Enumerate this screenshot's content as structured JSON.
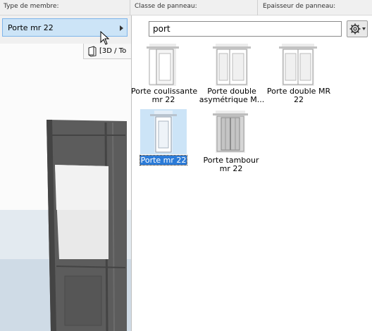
{
  "header": {
    "member_type_label": "Type de membre:",
    "panel_class_label": "Classe de panneau:",
    "panel_thickness_label": "Epaisseur de panneau:"
  },
  "selector": {
    "value": "Porte mr 22"
  },
  "view_tab": {
    "label": "[3D / To"
  },
  "search": {
    "value": "port"
  },
  "items": [
    {
      "line1": "Porte coulissante",
      "line2": "mr 22",
      "selected": false
    },
    {
      "line1": "Porte double",
      "line2": "asymétrique M...",
      "selected": false
    },
    {
      "line1": "Porte double MR",
      "line2": "22",
      "selected": false
    },
    {
      "line1": "Porte mr 22",
      "line2": "",
      "selected": true
    },
    {
      "line1": "Porte tambour",
      "line2": "mr 22",
      "selected": false
    }
  ],
  "icons": {
    "settings": "gear-icon",
    "expand": "chevron-right-icon",
    "view": "3d-view-icon",
    "cursor": "mouse-pointer-icon"
  }
}
